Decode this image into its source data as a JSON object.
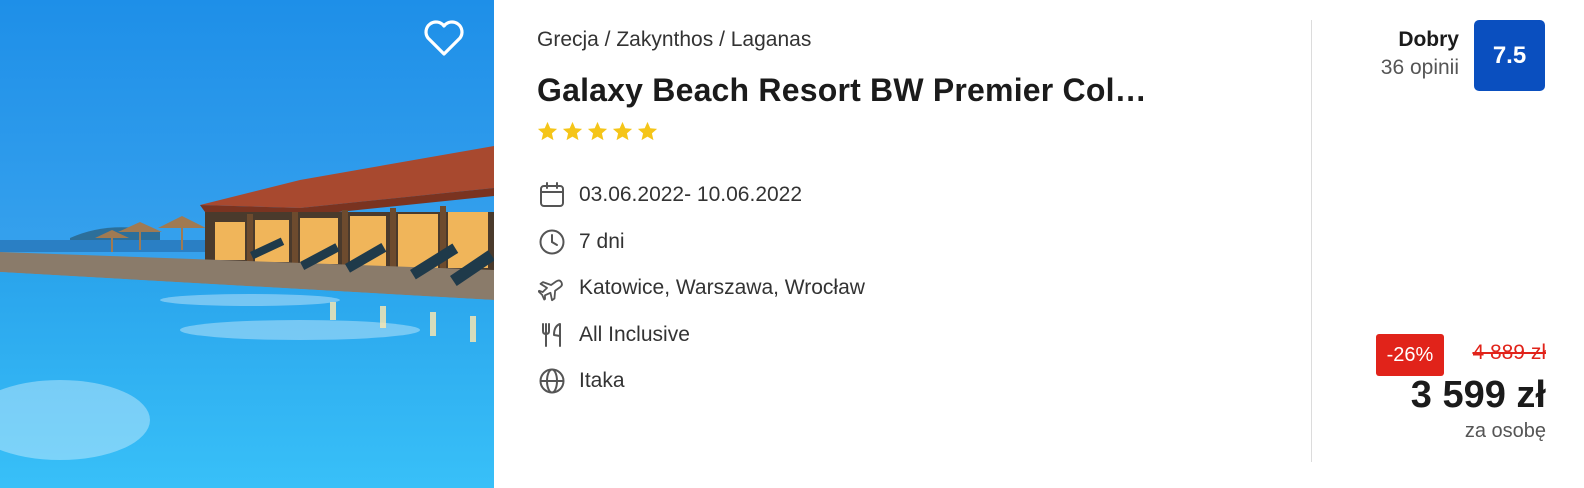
{
  "photo": {
    "alt": "Hotel pool at dusk with restaurant terrace"
  },
  "favorite": {
    "icon": "heart-icon"
  },
  "breadcrumb": "Grecja / Zakynthos / Laganas",
  "hotel": {
    "name": "Galaxy Beach Resort BW Premier Col…",
    "stars": 5
  },
  "features": [
    {
      "icon": "calendar-icon",
      "text": "03.06.2022- 10.06.2022"
    },
    {
      "icon": "clock-icon",
      "text": "7 dni"
    },
    {
      "icon": "plane-icon",
      "text": "Katowice, Warszawa, Wrocław"
    },
    {
      "icon": "cutlery-icon",
      "text": "All Inclusive"
    },
    {
      "icon": "globe-icon",
      "text": "Itaka"
    }
  ],
  "rating": {
    "label": "Dobry",
    "count": "36 opinii",
    "score": "7.5"
  },
  "price": {
    "discount": "-26%",
    "old": "4 889 zł",
    "current": "3 599 zł",
    "per": "za osobę"
  },
  "colors": {
    "accent": "#0a4fbf",
    "sale": "#e1231a",
    "star": "#f5c518"
  }
}
